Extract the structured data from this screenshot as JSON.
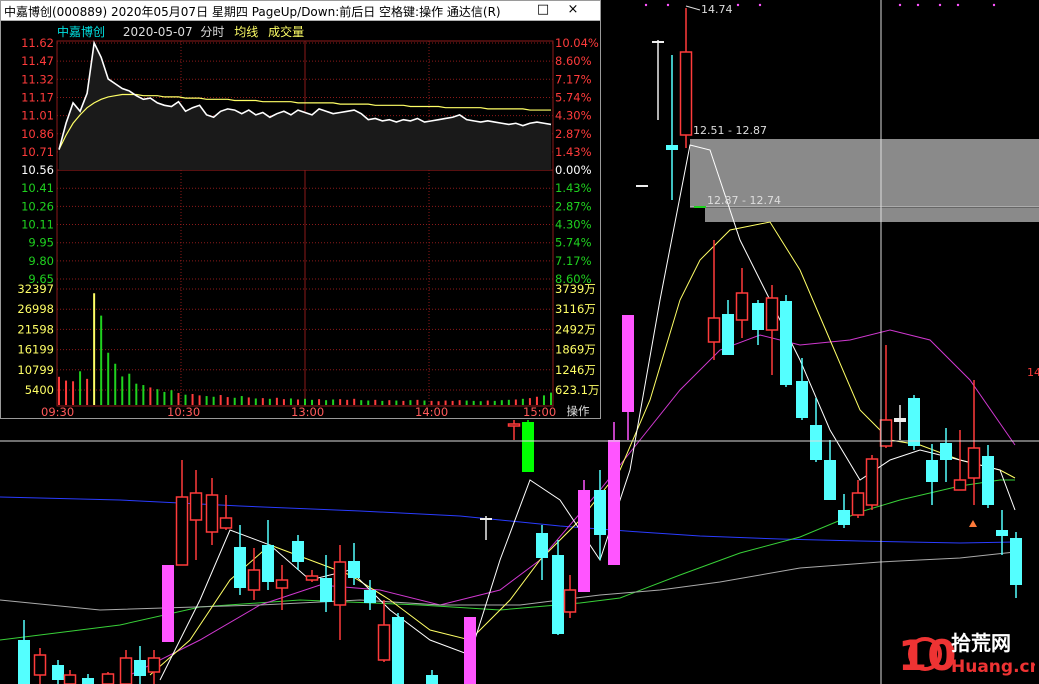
{
  "popup": {
    "title": "中嘉博创(000889) 2020年05月07日 星期四 PageUp/Down:前后日 空格键:操作 通达信(R)",
    "stock_name": "中嘉博创",
    "date": "2020-05-07",
    "mode": "分时",
    "avg_line_label": "均线",
    "volume_label": "成交量",
    "operate_label": "操作",
    "window_buttons": [
      "□",
      "×"
    ]
  },
  "chart_data": [
    {
      "type": "line",
      "name": "intraday-price",
      "price_ticks": [
        "11.62",
        "11.47",
        "11.32",
        "11.17",
        "11.01",
        "10.86",
        "10.71",
        "10.56",
        "10.41",
        "10.26",
        "10.11",
        "9.95",
        "9.80",
        "9.65"
      ],
      "percent_ticks": [
        "10.04%",
        "8.60%",
        "7.17%",
        "5.74%",
        "4.30%",
        "2.87%",
        "1.43%",
        "0.00%",
        "1.43%",
        "2.87%",
        "4.30%",
        "5.74%",
        "7.17%",
        "8.60%"
      ],
      "volume_ticks": [
        "32397",
        "26998",
        "21598",
        "16199",
        "10799",
        "5400"
      ],
      "volume_ticks_right": [
        "3739万",
        "3116万",
        "2492万",
        "1869万",
        "1246万",
        "623.1万"
      ],
      "time_ticks": [
        "09:30",
        "10:30",
        "13:00",
        "14:00",
        "15:00"
      ],
      "prev_close": 10.56,
      "ylim": [
        9.5,
        11.62
      ],
      "volume_max": 37800,
      "price": [
        10.73,
        10.95,
        11.12,
        11.05,
        11.2,
        11.62,
        11.5,
        11.32,
        11.28,
        11.24,
        11.22,
        11.18,
        11.15,
        11.16,
        11.12,
        11.1,
        11.09,
        11.13,
        11.05,
        11.08,
        11.1,
        11.02,
        11.0,
        11.05,
        11.07,
        11.06,
        11.03,
        11.06,
        11.02,
        11.04,
        11.0,
        11.03,
        11.05,
        11.02,
        11.06,
        11.04,
        11.02,
        11.07,
        11.05,
        11.03,
        11.04,
        11.05,
        11.06,
        11.03,
        10.98,
        10.99,
        10.97,
        10.98,
        10.96,
        10.98,
        10.97,
        10.99,
        10.96,
        10.97,
        10.98,
        10.99,
        11.0,
        11.02,
        10.98,
        10.97,
        10.96,
        10.97,
        10.96,
        10.95,
        10.94,
        10.95,
        10.93,
        10.95,
        10.96,
        10.95,
        10.94
      ],
      "avg": [
        10.73,
        10.85,
        10.95,
        11.02,
        11.08,
        11.12,
        11.15,
        11.17,
        11.18,
        11.19,
        11.19,
        11.19,
        11.18,
        11.18,
        11.18,
        11.17,
        11.17,
        11.17,
        11.16,
        11.16,
        11.16,
        11.15,
        11.15,
        11.15,
        11.15,
        11.14,
        11.14,
        11.14,
        11.14,
        11.13,
        11.13,
        11.13,
        11.13,
        11.13,
        11.12,
        11.12,
        11.12,
        11.12,
        11.12,
        11.12,
        11.11,
        11.11,
        11.11,
        11.11,
        11.11,
        11.1,
        11.1,
        11.1,
        11.1,
        11.1,
        11.09,
        11.09,
        11.09,
        11.09,
        11.09,
        11.08,
        11.08,
        11.08,
        11.08,
        11.08,
        11.08,
        11.07,
        11.07,
        11.07,
        11.07,
        11.07,
        11.07,
        11.06,
        11.06,
        11.06,
        11.06
      ],
      "volume": [
        8200,
        7100,
        6900,
        9800,
        7600,
        32500,
        26000,
        15200,
        12000,
        8300,
        9100,
        6200,
        5800,
        5100,
        4600,
        3800,
        4300,
        3500,
        3000,
        3200,
        2800,
        2600,
        2400,
        2900,
        2300,
        2100,
        2600,
        2200,
        1900,
        2000,
        1800,
        2100,
        1700,
        1900,
        1600,
        1800,
        1500,
        1700,
        1400,
        1600,
        1700,
        1500,
        1800,
        1400,
        1300,
        1500,
        1200,
        1400,
        1300,
        1200,
        1400,
        1500,
        1300,
        1200,
        1100,
        1300,
        1200,
        1400,
        1300,
        1200,
        1100,
        1300,
        1200,
        1400,
        1500,
        1600,
        1800,
        2000,
        2400,
        2800,
        3600
      ]
    },
    {
      "type": "candlestick",
      "name": "daily-kline",
      "annotations": [
        "14.74",
        "12.51 - 12.87",
        "12.87 - 12.74",
        "14"
      ],
      "candles_visible_count": 58
    }
  ],
  "watermark": {
    "text": "拾荒网",
    "sub": "Huang.cn",
    "number": "10"
  },
  "colors": {
    "up": "#ff3b3b",
    "down": "#54ffff",
    "limit": "#ff55ff",
    "flat": "#eeeeee",
    "price": "#ffffff",
    "avg": "#ffff66",
    "grid": "#8b1a1a",
    "rise": "#ff3b3b",
    "fall": "#1fd21f"
  }
}
